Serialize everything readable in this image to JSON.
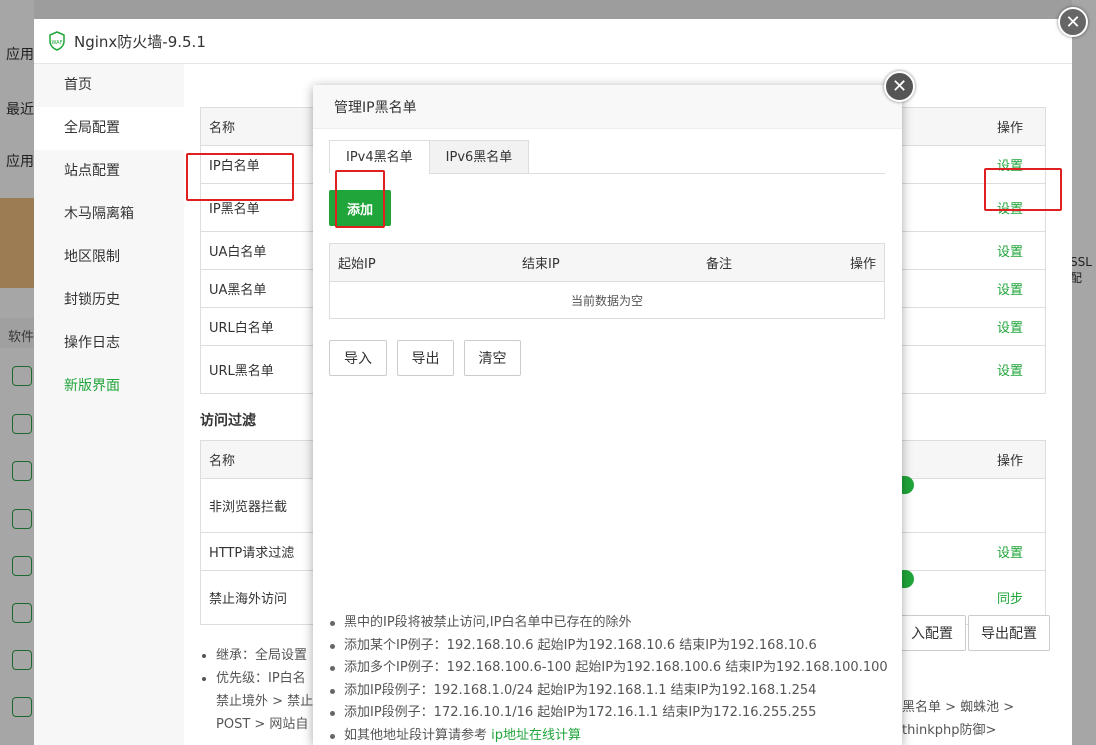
{
  "background": {
    "left_labels": [
      "应用",
      "最近",
      "应用"
    ],
    "software_label": "软件",
    "right_partial": "SSL配"
  },
  "waf": {
    "title": "Nginx防火墙-9.5.1",
    "nav": [
      "首页",
      "全局配置",
      "站点配置",
      "木马隔离箱",
      "地区限制",
      "封锁历史",
      "操作日志",
      "新版界面"
    ],
    "active_nav": "全局配置",
    "table1": {
      "header": {
        "name": "名称",
        "op": "操作"
      },
      "rows": [
        {
          "name": "IP白名单",
          "op": "设置"
        },
        {
          "name": "IP黑名单",
          "op": "设置"
        },
        {
          "name": "UA白名单",
          "op": "设置"
        },
        {
          "name": "UA黑名单",
          "op": "设置"
        },
        {
          "name": "URL白名单",
          "op": "设置"
        },
        {
          "name": "URL黑名单",
          "op": "设置"
        }
      ]
    },
    "section_title": "访问过滤",
    "table2": {
      "header": {
        "name": "名称",
        "op": "操作"
      },
      "rows": [
        {
          "name": "非浏览器拦截",
          "op": ""
        },
        {
          "name": "HTTP请求过滤",
          "op": "设置"
        },
        {
          "name": "禁止海外访问",
          "op": "同步"
        }
      ]
    },
    "import_config": "入配置",
    "export_config": "导出配置",
    "notes": [
      "继承：全局设置",
      "优先级：IP白名",
      "禁止境外 > 禁止",
      "POST > 网站自"
    ],
    "right_notes": [
      "黑名单 > 蜘蛛池 >",
      "thinkphp防御>"
    ]
  },
  "modal": {
    "title": "管理IP黑名单",
    "tabs": [
      "IPv4黑名单",
      "IPv6黑名单"
    ],
    "add_label": "添加",
    "columns": [
      "起始IP",
      "结束IP",
      "备注",
      "操作"
    ],
    "empty_text": "当前数据为空",
    "actions": [
      "导入",
      "导出",
      "清空"
    ],
    "help": [
      "黑中的IP段将被禁止访问,IP白名单中已存在的除外",
      "添加某个IP例子：192.168.10.6 起始IP为192.168.10.6 结束IP为192.168.10.6",
      "添加多个IP例子：192.168.100.6-100 起始IP为192.168.100.6 结束IP为192.168.100.100",
      "添加IP段例子：192.168.1.0/24 起始IP为192.168.1.1 结束IP为192.168.1.254",
      "添加IP段例子：172.16.10.1/16 起始IP为172.16.1.1 结束IP为172.16.255.255"
    ],
    "help_last_prefix": "如其他地址段计算请参考",
    "help_last_link": "ip地址在线计算"
  },
  "colors": {
    "accent": "#20a53a",
    "highlight": "#e02020"
  }
}
